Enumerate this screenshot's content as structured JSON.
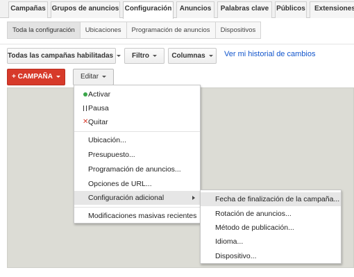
{
  "tabs": [
    {
      "label": "Campañas"
    },
    {
      "label": "Grupos de anuncios"
    },
    {
      "label": "Configuración"
    },
    {
      "label": "Anuncios"
    },
    {
      "label": "Palabras clave"
    },
    {
      "label": "Públicos"
    },
    {
      "label": "Extensiones de"
    }
  ],
  "subtabs": [
    {
      "label": "Toda la configuración"
    },
    {
      "label": "Ubicaciones"
    },
    {
      "label": "Programación de anuncios"
    },
    {
      "label": "Dispositivos"
    }
  ],
  "toolbar": {
    "campaigns_filter": "Todas las campañas habilitadas",
    "filter": "Filtro",
    "columns": "Columnas",
    "history_link": "Ver mi historial de cambios",
    "add_campaign": "+ CAMPAÑA",
    "edit": "Editar"
  },
  "edit_menu": {
    "status_items": [
      "Activar",
      "Pausa",
      "Quitar"
    ],
    "items": [
      "Ubicación...",
      "Presupuesto...",
      "Programación de anuncios...",
      "Opciones de URL...",
      "Configuración adicional"
    ],
    "bulk": "Modificaciones masivas recientes"
  },
  "submenu": {
    "items": [
      "Fecha de finalización de la campaña...",
      "Rotación de anuncios...",
      "Método de publicación...",
      "Idioma...",
      "Dispositivo..."
    ]
  },
  "colors": {
    "accent_red": "#d73a2a",
    "link_blue": "#1155cc",
    "active_green": "#3aa64a"
  }
}
